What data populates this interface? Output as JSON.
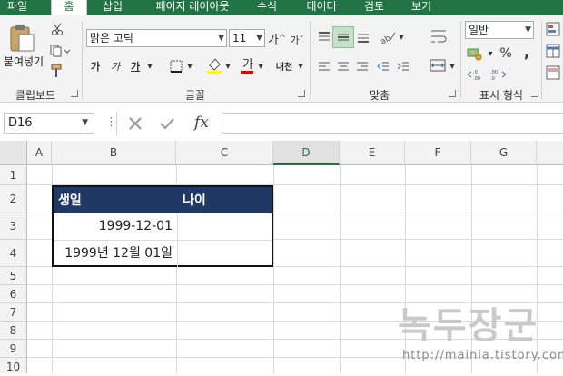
{
  "ribbon_tabs": [
    "파일",
    "홈",
    "삽입",
    "페이지 레이아웃",
    "수식",
    "데이터",
    "검토",
    "보기"
  ],
  "clipboard": {
    "paste_label": "붙여넣기",
    "group_label": "클립보드"
  },
  "font": {
    "name": "맑은 고딕",
    "size": "11",
    "group_label": "글꼴",
    "grow": "가",
    "shrink": "가",
    "bold": "가",
    "italic": "가",
    "underline": "가",
    "phonetic": "내천"
  },
  "alignment": {
    "group_label": "맞춤"
  },
  "number": {
    "format": "일반",
    "group_label": "표시 형식",
    "percent": "%",
    "comma": ","
  },
  "formula_bar": {
    "name_box": "D16",
    "fx": "fx",
    "formula": ""
  },
  "columns": [
    "A",
    "B",
    "C",
    "D",
    "E",
    "F",
    "G"
  ],
  "selected_column": "D",
  "rows": [
    "1",
    "2",
    "3",
    "4",
    "5",
    "6",
    "7",
    "8",
    "9",
    "10"
  ],
  "table": {
    "header_date": "생일",
    "header_age": "나이",
    "r3_date": "1999-12-01",
    "r4_date": "1999년 12월 01일"
  },
  "colors": {
    "ribbon_green": "#217346",
    "table_header": "#1f3864"
  },
  "watermark": {
    "title": "녹두장군",
    "url": "http://mainia.tistory.com"
  }
}
